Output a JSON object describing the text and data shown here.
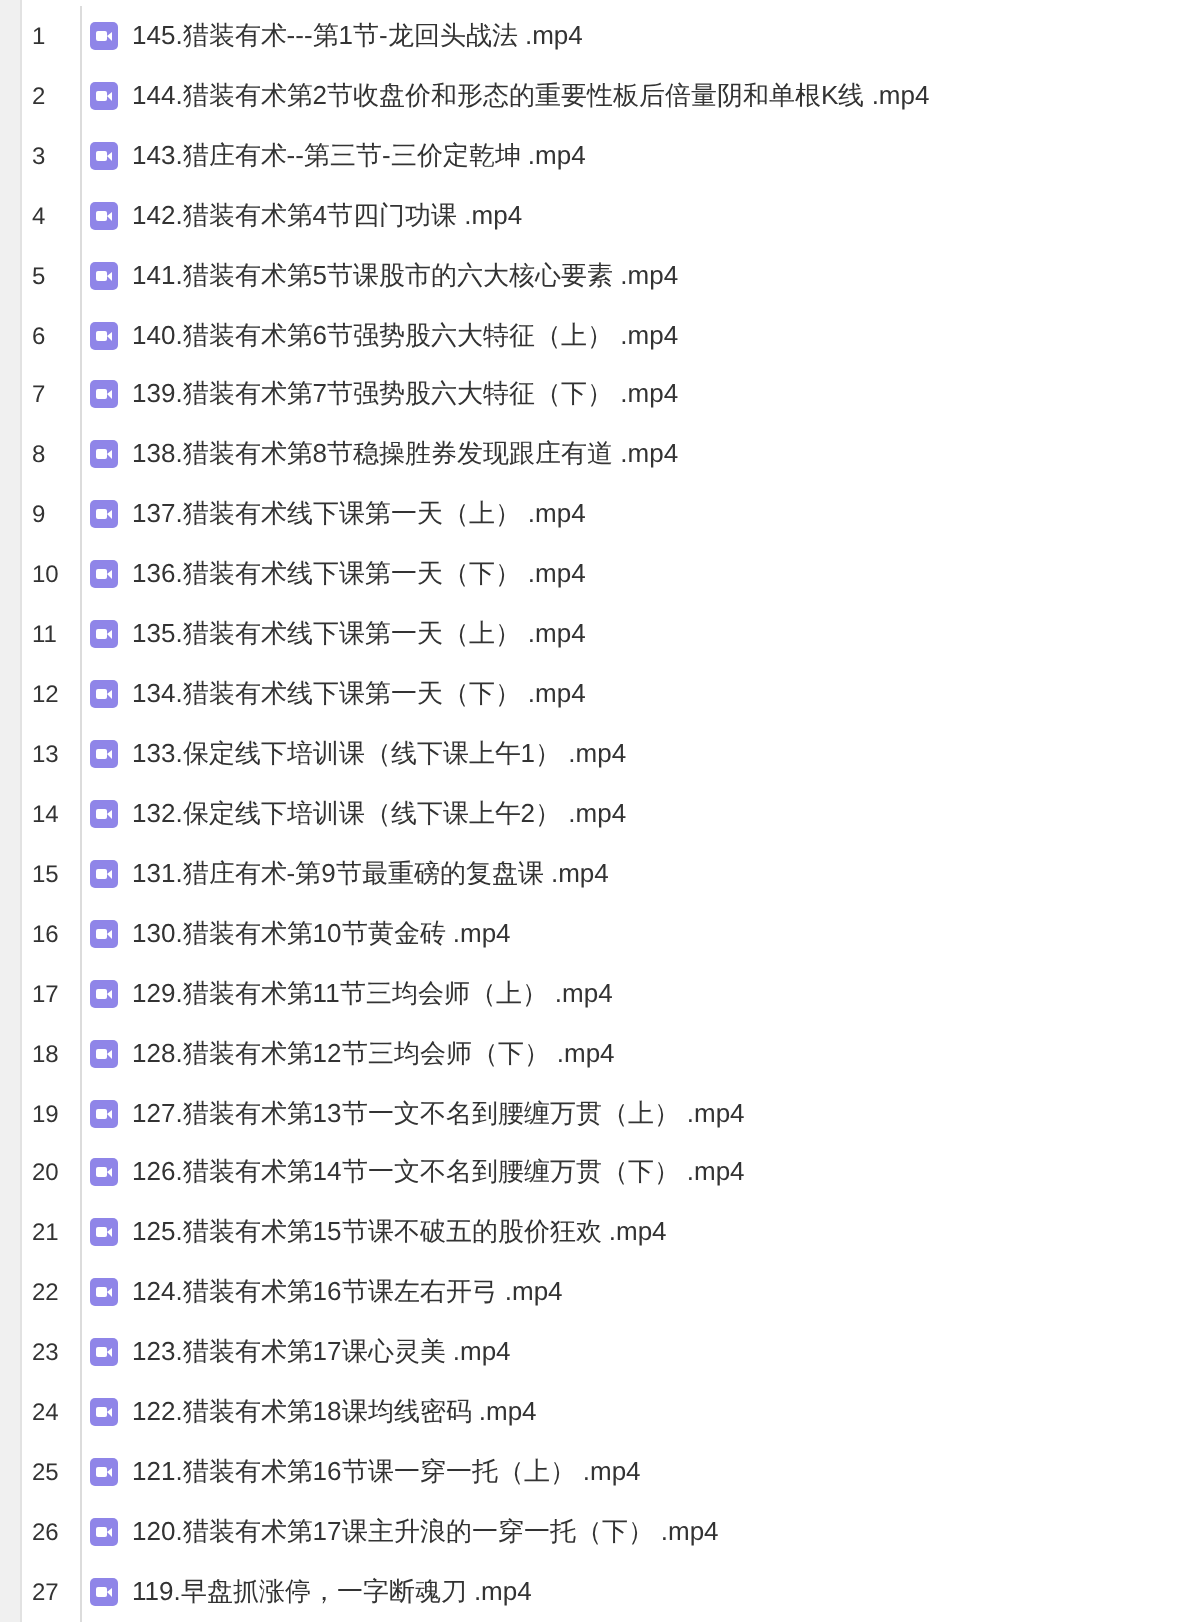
{
  "files": [
    {
      "number": "1",
      "name": "145.猎装有术---第1节-龙回头战法 .mp4"
    },
    {
      "number": "2",
      "name": "144.猎装有术第2节收盘价和形态的重要性板后倍量阴和单根K线 .mp4"
    },
    {
      "number": "3",
      "name": "143.猎庄有术--第三节-三价定乾坤 .mp4"
    },
    {
      "number": "4",
      "name": "142.猎装有术第4节四门功课 .mp4"
    },
    {
      "number": "5",
      "name": "141.猎装有术第5节课股市的六大核心要素 .mp4"
    },
    {
      "number": "6",
      "name": "140.猎装有术第6节强势股六大特征（上） .mp4"
    },
    {
      "number": "7",
      "name": "139.猎装有术第7节强势股六大特征（下） .mp4"
    },
    {
      "number": "8",
      "name": "138.猎装有术第8节稳操胜券发现跟庄有道 .mp4"
    },
    {
      "number": "9",
      "name": "137.猎装有术线下课第一天（上） .mp4"
    },
    {
      "number": "10",
      "name": "136.猎装有术线下课第一天（下） .mp4"
    },
    {
      "number": "11",
      "name": "135.猎装有术线下课第一天（上） .mp4"
    },
    {
      "number": "12",
      "name": "134.猎装有术线下课第一天（下） .mp4"
    },
    {
      "number": "13",
      "name": "133.保定线下培训课（线下课上午1） .mp4"
    },
    {
      "number": "14",
      "name": "132.保定线下培训课（线下课上午2） .mp4"
    },
    {
      "number": "15",
      "name": "131.猎庄有术-第9节最重磅的复盘课 .mp4"
    },
    {
      "number": "16",
      "name": "130.猎装有术第10节黄金砖 .mp4"
    },
    {
      "number": "17",
      "name": "129.猎装有术第11节三均会师（上） .mp4"
    },
    {
      "number": "18",
      "name": "128.猎装有术第12节三均会师（下） .mp4"
    },
    {
      "number": "19",
      "name": "127.猎装有术第13节一文不名到腰缠万贯（上） .mp4"
    },
    {
      "number": "20",
      "name": "126.猎装有术第14节一文不名到腰缠万贯（下） .mp4"
    },
    {
      "number": "21",
      "name": "125.猎装有术第15节课不破五的股价狂欢 .mp4"
    },
    {
      "number": "22",
      "name": "124.猎装有术第16节课左右开弓 .mp4"
    },
    {
      "number": "23",
      "name": "123.猎装有术第17课心灵美 .mp4"
    },
    {
      "number": "24",
      "name": "122.猎装有术第18课均线密码 .mp4"
    },
    {
      "number": "25",
      "name": "121.猎装有术第16节课一穿一托（上） .mp4"
    },
    {
      "number": "26",
      "name": "120.猎装有术第17课主升浪的一穿一托（下） .mp4"
    },
    {
      "number": "27",
      "name": "119.早盘抓涨停，一字断魂刀 .mp4"
    }
  ]
}
